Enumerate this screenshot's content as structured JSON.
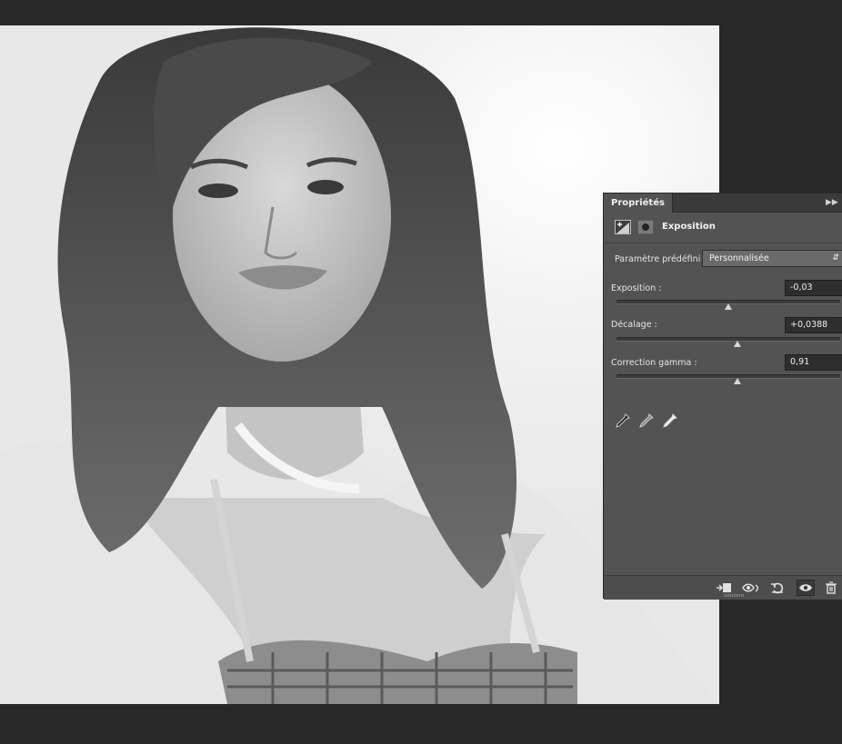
{
  "panel": {
    "tab_label": "Propriétés",
    "title": "Exposition",
    "preset": {
      "label": "Paramètre prédéfini :",
      "value": "Personnalisée"
    },
    "params": [
      {
        "label": "Exposition :",
        "value": "-0,03",
        "slider_fraction": 0.5
      },
      {
        "label": "Décalage :",
        "value": "+0,0388",
        "slider_fraction": 0.54
      },
      {
        "label": "Correction gamma :",
        "value": "0,91",
        "slider_fraction": 0.54
      }
    ],
    "eyedroppers": [
      "eyedropper-black-icon",
      "eyedropper-gray-icon",
      "eyedropper-white-icon"
    ],
    "bottom_buttons": [
      "clip-to-layer-icon",
      "view-previous-icon",
      "reset-icon",
      "visibility-eye-icon",
      "delete-trash-icon"
    ]
  },
  "colors": {
    "app_background": "#282828",
    "panel_background": "#535353",
    "panel_text": "#e6e6e6",
    "field_background": "#2e2e2e"
  }
}
